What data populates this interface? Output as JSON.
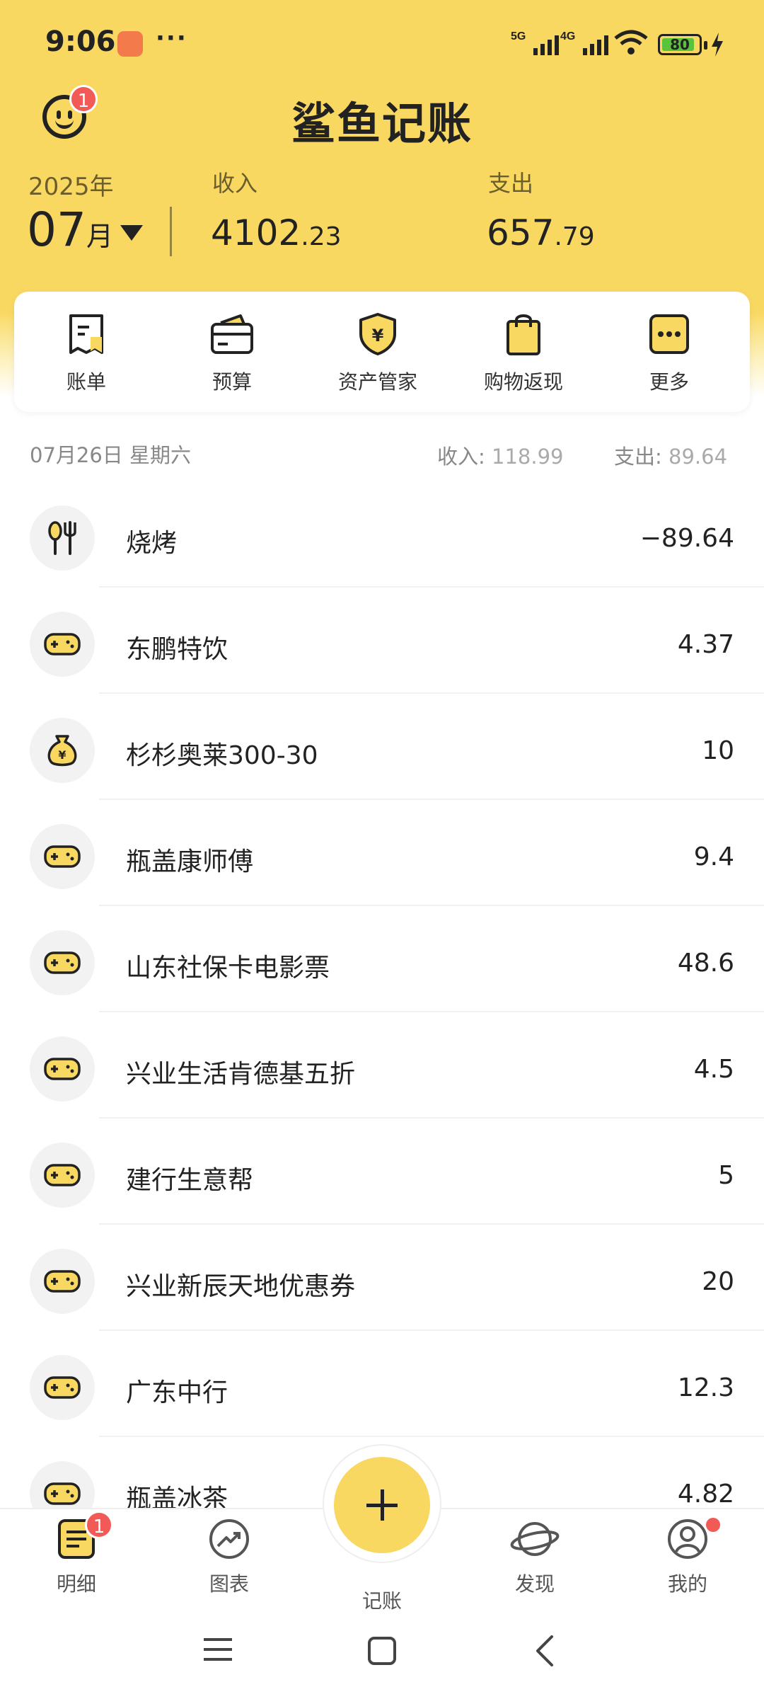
{
  "status_bar": {
    "time": "9:06",
    "dots": "···",
    "net1": "5G",
    "net2": "4G",
    "battery": "80"
  },
  "header": {
    "title": "鲨鱼记账",
    "notification_count": "1"
  },
  "summary": {
    "year": "2025年",
    "month": "07",
    "month_unit": "月",
    "income_label": "收入",
    "income_int": "4102",
    "income_dec": ".23",
    "expense_label": "支出",
    "expense_int": "657",
    "expense_dec": ".79"
  },
  "shortcuts": [
    {
      "label": "账单",
      "icon": "bill-icon"
    },
    {
      "label": "预算",
      "icon": "budget-wallet-icon"
    },
    {
      "label": "资产管家",
      "icon": "asset-shield-icon"
    },
    {
      "label": "购物返现",
      "icon": "shopping-bag-icon"
    },
    {
      "label": "更多",
      "icon": "more-icon"
    }
  ],
  "day": {
    "date": "07月26日 星期六",
    "income_label": "收入:",
    "income_value": "118.99",
    "expense_label": "支出:",
    "expense_value": "89.64"
  },
  "transactions": [
    {
      "name": "烧烤",
      "amount": "−89.64",
      "icon": "food-icon"
    },
    {
      "name": "东鹏特饮",
      "amount": "4.37",
      "icon": "gamepad-icon"
    },
    {
      "name": "杉杉奥莱300-30",
      "amount": "10",
      "icon": "money-bag-icon"
    },
    {
      "name": "瓶盖康师傅",
      "amount": "9.4",
      "icon": "gamepad-icon"
    },
    {
      "name": "山东社保卡电影票",
      "amount": "48.6",
      "icon": "gamepad-icon"
    },
    {
      "name": "兴业生活肯德基五折",
      "amount": "4.5",
      "icon": "gamepad-icon"
    },
    {
      "name": "建行生意帮",
      "amount": "5",
      "icon": "gamepad-icon"
    },
    {
      "name": "兴业新辰天地优惠券",
      "amount": "20",
      "icon": "gamepad-icon"
    },
    {
      "name": "广东中行",
      "amount": "12.3",
      "icon": "gamepad-icon"
    },
    {
      "name": "瓶盖冰茶",
      "amount": "4.82",
      "icon": "gamepad-icon"
    }
  ],
  "bottom_nav": {
    "details": "明细",
    "details_badge": "1",
    "charts": "图表",
    "record": "记账",
    "discover": "发现",
    "mine": "我的"
  },
  "colors": {
    "brand_yellow": "#F9D862",
    "badge_red": "#F25A57"
  }
}
